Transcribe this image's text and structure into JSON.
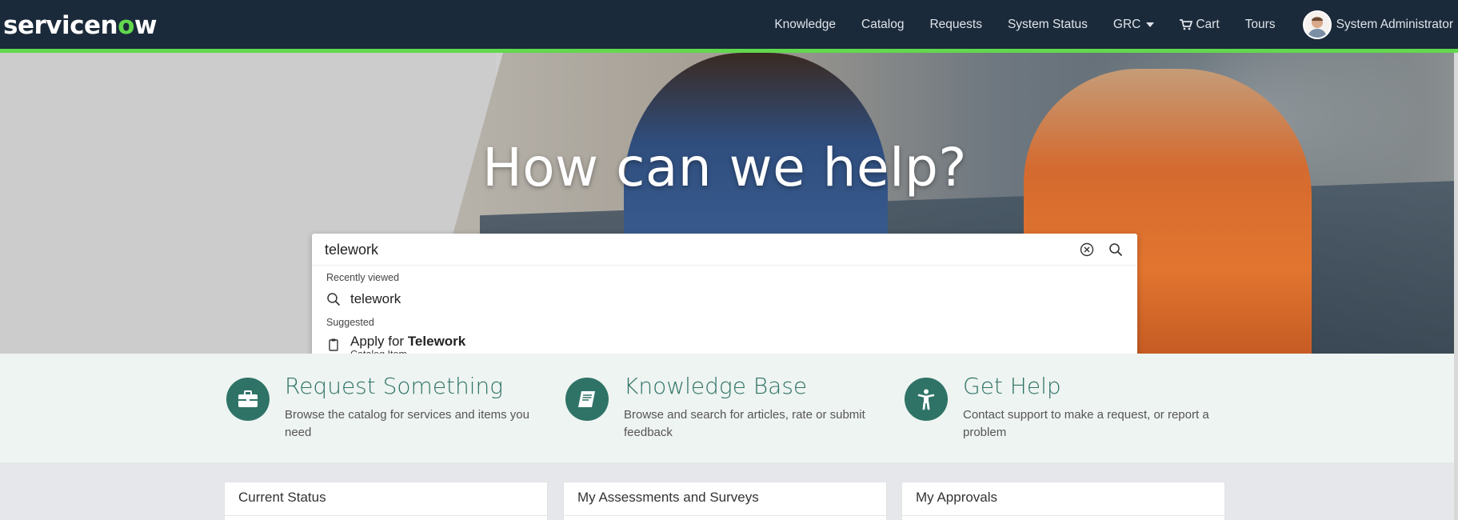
{
  "header": {
    "logo_prefix": "servicen",
    "logo_o": "o",
    "logo_suffix": "w",
    "nav": [
      {
        "label": "Knowledge"
      },
      {
        "label": "Catalog"
      },
      {
        "label": "Requests"
      },
      {
        "label": "System Status"
      },
      {
        "label": "GRC"
      },
      {
        "label": "Cart"
      },
      {
        "label": "Tours"
      }
    ],
    "user_name": "System Administrator"
  },
  "hero": {
    "title": "How can we help?"
  },
  "search": {
    "value": "telework",
    "recent_label": "Recently viewed",
    "recent_items": [
      "telework"
    ],
    "suggested_label": "Suggested",
    "suggested_items": [
      {
        "prefix": "Apply for ",
        "highlight": "Telework",
        "type": "Catalog Item"
      }
    ]
  },
  "quick_links": [
    {
      "title": "Request Something",
      "description": "Browse the catalog for services and items you need",
      "icon": "briefcase-icon"
    },
    {
      "title": "Knowledge Base",
      "description": "Browse and search for articles, rate or submit feedback",
      "icon": "book-icon"
    },
    {
      "title": "Get Help",
      "description": "Contact support to make a request, or report a problem",
      "icon": "accessibility-icon"
    }
  ],
  "widgets": [
    {
      "title": "Current Status"
    },
    {
      "title": "My Assessments and Surveys"
    },
    {
      "title": "My Approvals"
    }
  ],
  "colors": {
    "header_bg": "#1b2a3a",
    "accent_green": "#62d84e",
    "quick_link_teal": "#2f7367"
  }
}
